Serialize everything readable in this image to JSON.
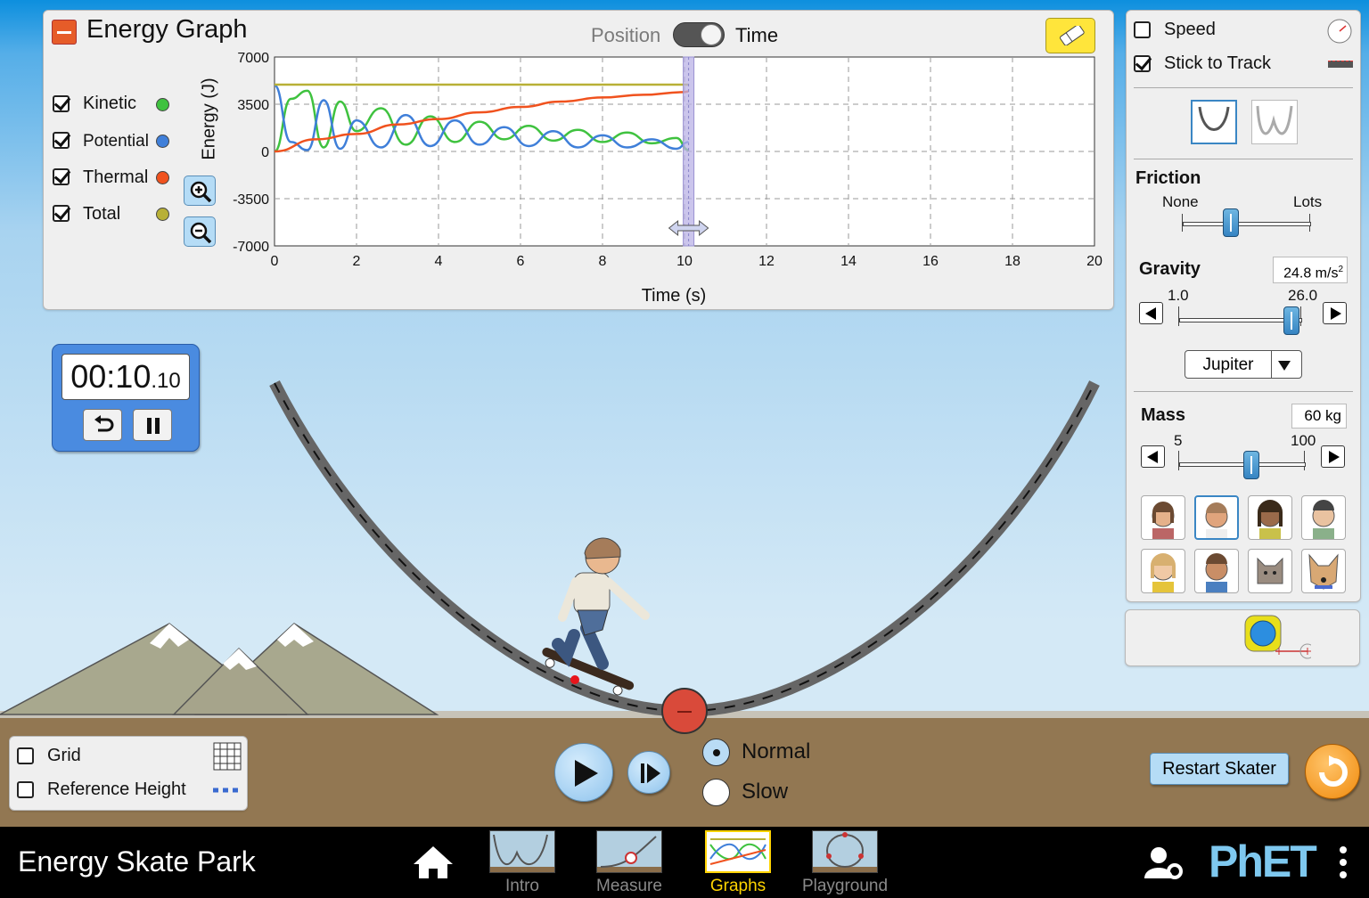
{
  "app": {
    "title": "Energy Skate Park"
  },
  "nav": {
    "screens": [
      {
        "label": "Intro"
      },
      {
        "label": "Measure"
      },
      {
        "label": "Graphs",
        "selected": true
      },
      {
        "label": "Playground"
      }
    ],
    "icons": [
      "home-icon",
      "user-settings-icon",
      "menu-icon"
    ],
    "brand": "PhET"
  },
  "graph": {
    "title": "Energy Graph",
    "toggle": {
      "left": "Position",
      "right": "Time",
      "selected": "Time"
    },
    "legend": [
      {
        "label": "Kinetic",
        "checked": true,
        "color": "#3fc23f"
      },
      {
        "label": "Potential",
        "checked": true,
        "color": "#3f7fd9"
      },
      {
        "label": "Thermal",
        "checked": true,
        "color": "#f0521e"
      },
      {
        "label": "Total",
        "checked": true,
        "color": "#b8b036"
      }
    ],
    "ylabel": "Energy (J)",
    "xlabel": "Time (s)",
    "y_ticks": [
      "7000",
      "3500",
      "0",
      "-3500",
      "-7000"
    ],
    "x_ticks": [
      "0",
      "2",
      "4",
      "6",
      "8",
      "10",
      "12",
      "14",
      "16",
      "18",
      "20"
    ]
  },
  "chart_data": {
    "type": "line",
    "xlabel": "Time (s)",
    "ylabel": "Energy (J)",
    "xlim": [
      0,
      20
    ],
    "ylim": [
      -7000,
      7000
    ],
    "grid": true,
    "cursor_time": 10.1,
    "series": [
      {
        "name": "Kinetic",
        "color": "#3fc23f",
        "x": [
          0,
          0.4,
          0.8,
          1.2,
          1.6,
          2.0,
          2.6,
          3.2,
          3.8,
          4.4,
          5.0,
          5.6,
          6.2,
          6.8,
          7.4,
          8.0,
          8.6,
          9.2,
          9.8,
          10.1
        ],
        "y": [
          0,
          3900,
          4500,
          300,
          3700,
          1500,
          3200,
          500,
          2600,
          700,
          2200,
          900,
          1900,
          800,
          1600,
          700,
          1400,
          600,
          1000,
          100
        ]
      },
      {
        "name": "Potential",
        "color": "#3f7fd9",
        "x": [
          0,
          0.4,
          0.8,
          1.2,
          1.6,
          2.0,
          2.6,
          3.2,
          3.8,
          4.4,
          5.0,
          5.6,
          6.2,
          6.8,
          7.4,
          8.0,
          8.6,
          9.2,
          9.8,
          10.1
        ],
        "y": [
          4900,
          700,
          100,
          3800,
          200,
          2300,
          300,
          2700,
          400,
          2300,
          500,
          1800,
          400,
          1500,
          300,
          1200,
          300,
          900,
          200,
          700
        ]
      },
      {
        "name": "Thermal",
        "color": "#f0521e",
        "x": [
          0,
          1,
          2,
          3,
          4,
          5,
          6,
          7,
          8,
          9,
          10,
          10.1
        ],
        "y": [
          0,
          900,
          1300,
          2000,
          2400,
          2900,
          3300,
          3700,
          4000,
          4200,
          4400,
          4450
        ]
      },
      {
        "name": "Total",
        "color": "#b8b036",
        "x": [
          0,
          10.1
        ],
        "y": [
          4950,
          4950
        ]
      }
    ]
  },
  "timer": {
    "display": "00:10",
    "fraction": ".10"
  },
  "controls": {
    "speed_label": "Speed",
    "speed_checked": false,
    "stick_label": "Stick to Track",
    "stick_checked": true,
    "friction_title": "Friction",
    "friction_min": "None",
    "friction_max": "Lots",
    "friction_value": 0.38,
    "gravity_title": "Gravity",
    "gravity_value": "24.8 m/s",
    "gravity_unit_sup": "2",
    "gravity_min": "1.0",
    "gravity_max": "26.0",
    "gravity_fraction": 0.93,
    "planet": "Jupiter",
    "mass_title": "Mass",
    "mass_value": "60 kg",
    "mass_min": "5",
    "mass_max": "100",
    "mass_fraction": 0.58
  },
  "bottom": {
    "grid_label": "Grid",
    "grid_checked": false,
    "refheight_label": "Reference Height",
    "refheight_checked": false,
    "speed_options": [
      {
        "label": "Normal",
        "selected": true
      },
      {
        "label": "Slow",
        "selected": false
      }
    ],
    "restart_label": "Restart Skater"
  },
  "colors": {
    "sky": "#c9e2f3",
    "ground": "#927752",
    "nav_selected": "#ffd400",
    "accent_blue": "#3a86c4",
    "timer_blue": "#4a8be0"
  }
}
